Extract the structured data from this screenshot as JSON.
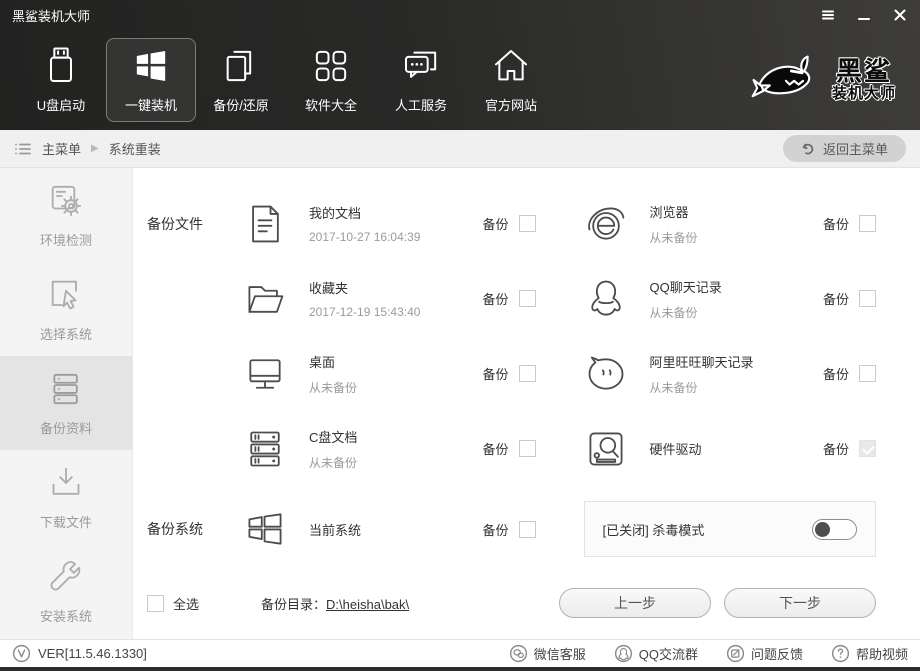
{
  "colors": {
    "header_dark": "#292928",
    "panel_gray": "#f4f4f4",
    "text_dark": "#333333",
    "text_muted": "#9b9b9b"
  },
  "window": {
    "title": "黑鲨装机大师"
  },
  "nav": {
    "items": [
      {
        "label": "U盘启动"
      },
      {
        "label": "一键装机"
      },
      {
        "label": "备份/还原"
      },
      {
        "label": "软件大全"
      },
      {
        "label": "人工服务"
      },
      {
        "label": "官方网站"
      }
    ],
    "logo_line1": "黑鲨",
    "logo_line2": "装机大师"
  },
  "breadcrumb": {
    "root": "主菜单",
    "current": "系统重装",
    "back_button": "返回主菜单"
  },
  "sidebar": {
    "items": [
      {
        "label": "环境检测"
      },
      {
        "label": "选择系统"
      },
      {
        "label": "备份资料"
      },
      {
        "label": "下载文件"
      },
      {
        "label": "安装系统"
      }
    ]
  },
  "main": {
    "group_files": "备份文件",
    "group_system": "备份系统",
    "backup_label": "备份",
    "items": [
      {
        "name": "我的文档",
        "status": "2017-10-27 16:04:39"
      },
      {
        "name": "浏览器",
        "status": "从未备份"
      },
      {
        "name": "收藏夹",
        "status": "2017-12-19 15:43:40"
      },
      {
        "name": "QQ聊天记录",
        "status": "从未备份"
      },
      {
        "name": "桌面",
        "status": "从未备份"
      },
      {
        "name": "阿里旺旺聊天记录",
        "status": "从未备份"
      },
      {
        "name": "C盘文档",
        "status": "从未备份"
      },
      {
        "name": "硬件驱动",
        "status": ""
      },
      {
        "name": "当前系统",
        "status": ""
      }
    ],
    "antivirus_label": "[已关闭] 杀毒模式",
    "select_all": "全选",
    "dir_label": "备份目录：",
    "dir_value": "D:\\heisha\\bak\\",
    "prev_button": "上一步",
    "next_button": "下一步"
  },
  "statusbar": {
    "version": "VER[11.5.46.1330]",
    "links": [
      {
        "label": "微信客服"
      },
      {
        "label": "QQ交流群"
      },
      {
        "label": "问题反馈"
      },
      {
        "label": "帮助视频"
      }
    ]
  }
}
